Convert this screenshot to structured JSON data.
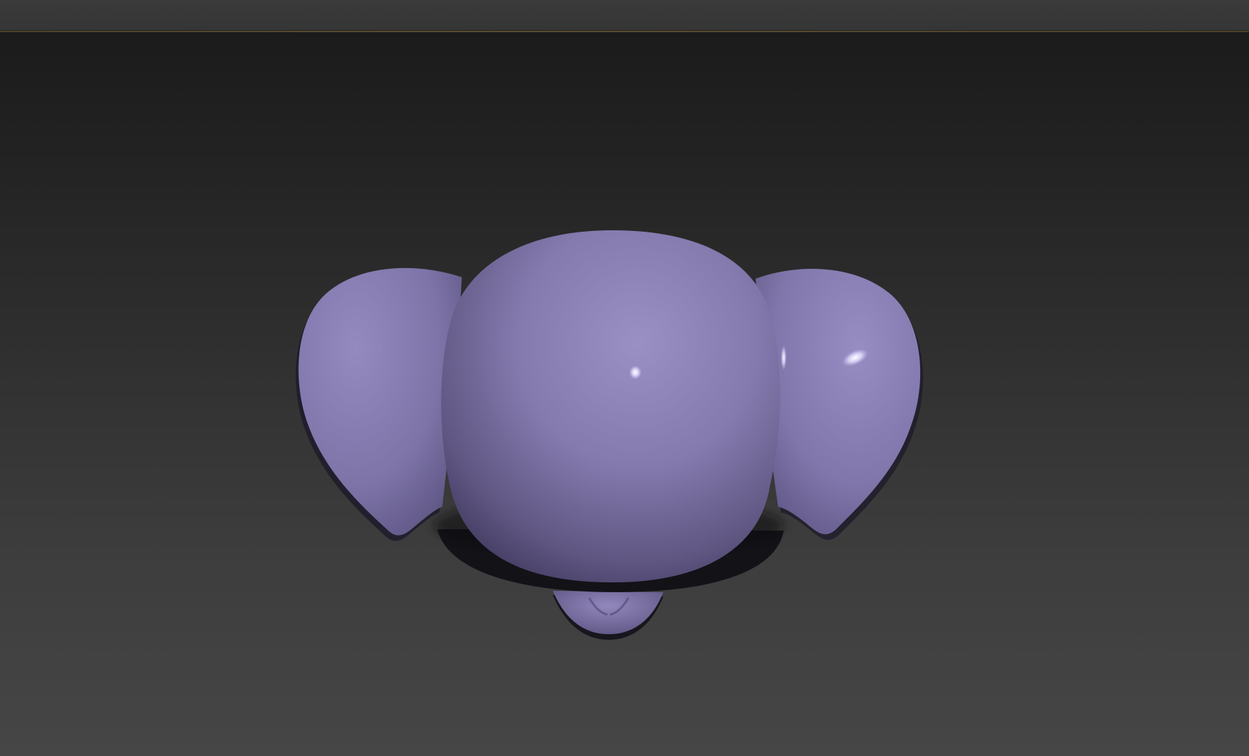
{
  "colors": {
    "viewport_top": "#1b1b1b",
    "viewport_bottom": "#464646",
    "model_base": "#8a7fb0",
    "model_light": "#9a90c2",
    "model_shadow": "#3a3455",
    "toolbar_edge": "#6b5a33"
  },
  "viewport": {
    "shading": "smooth-highlights",
    "object": "elephant-head-model"
  }
}
